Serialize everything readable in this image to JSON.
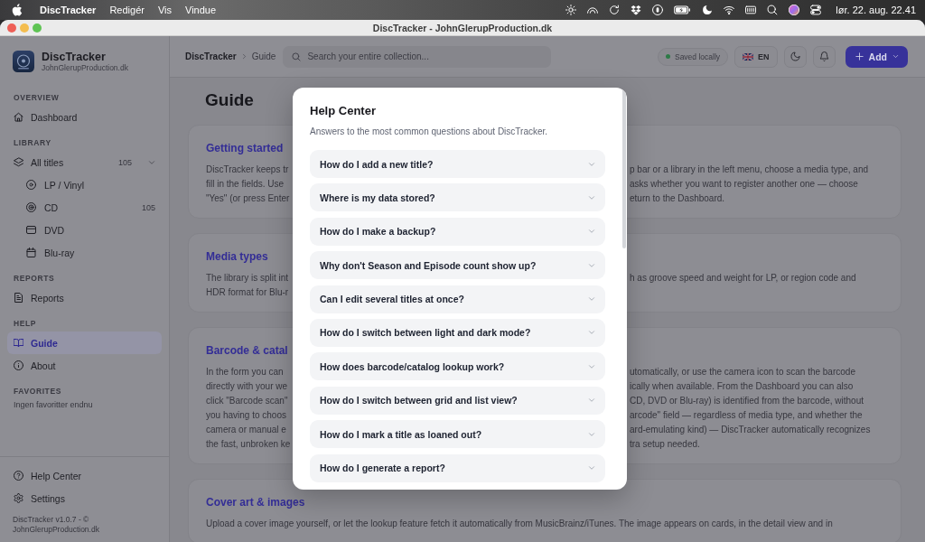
{
  "menu_bar": {
    "app_name": "DiscTracker",
    "menus": [
      "Redigér",
      "Vis",
      "Vindue"
    ],
    "clock": "lør. 22. aug. 22.41"
  },
  "window": {
    "title": "DiscTracker - JohnGlerupProduction.dk"
  },
  "sidebar": {
    "app_name": "DiscTracker",
    "app_subtitle": "JohnGlerupProduction.dk",
    "sections": [
      {
        "label": "OVERVIEW",
        "items": [
          {
            "label": "Dashboard",
            "selected": false
          }
        ]
      },
      {
        "label": "LIBRARY",
        "items": [
          {
            "label": "All titles",
            "count": "105",
            "expanded": true,
            "selected": false,
            "children": [
              {
                "label": "LP / Vinyl",
                "selected": false
              },
              {
                "label": "CD",
                "count": "105",
                "selected": false
              },
              {
                "label": "DVD",
                "selected": false
              },
              {
                "label": "Blu-ray",
                "selected": false
              }
            ]
          }
        ]
      },
      {
        "label": "REPORTS",
        "items": [
          {
            "label": "Reports",
            "selected": false
          }
        ]
      },
      {
        "label": "HELP",
        "items": [
          {
            "label": "Guide",
            "selected": true
          },
          {
            "label": "About",
            "selected": false
          }
        ]
      },
      {
        "label": "FAVORITES",
        "empty_text": "Ingen favoritter endnu"
      }
    ],
    "bottom_items": [
      {
        "label": "Help Center",
        "selected": false
      },
      {
        "label": "Settings",
        "selected": false
      }
    ],
    "footer": "DiscTracker v1.0.7 - © JohnGlerupProduction.dk"
  },
  "top_bar": {
    "breadcrumb": [
      "DiscTracker",
      "Guide"
    ],
    "search": {
      "placeholder": "Search your entire collection..."
    },
    "save_status": "Saved locally",
    "language": "EN",
    "add_button": "Add"
  },
  "page": {
    "title": "Guide",
    "sections": [
      {
        "heading": "Getting started",
        "lines": [
          {
            "left": "DiscTracker keeps tr",
            "right": "p bar or a library in the left menu, choose a media type, and"
          },
          {
            "left": "fill in the fields. Use",
            "right": "asks whether you want to register another one — choose"
          },
          {
            "left": "\"Yes\" (or press Enter",
            "right": "eturn to the Dashboard."
          }
        ]
      },
      {
        "heading": "Media types",
        "lines": [
          {
            "left": "The library is split int",
            "right": "h as groove speed and weight for LP, or region code and"
          },
          {
            "left": "HDR format for Blu-r"
          }
        ]
      },
      {
        "heading": "Barcode & catal",
        "lines": [
          {
            "left": "In the form you can",
            "right": "utomatically, or use the camera icon to scan the barcode"
          },
          {
            "left": "directly with your we",
            "right": "ically when available. From the Dashboard you can also"
          },
          {
            "left": "click \"Barcode scan\"",
            "right": "CD, DVD or Blu-ray) is identified from the barcode, without"
          },
          {
            "left": "you having to choos",
            "right": "arcode\" field — regardless of media type, and whether the"
          },
          {
            "left": "camera or manual e",
            "right": "ard-emulating kind) — DiscTracker automatically recognizes"
          },
          {
            "left": "the fast, unbroken ke",
            "right": "tra setup needed."
          }
        ]
      },
      {
        "heading": "Cover art & images",
        "lines": [
          {
            "text": "Upload a cover image yourself, or let the lookup feature fetch it automatically from MusicBrainz/iTunes. The image appears on cards, in the detail view and in"
          }
        ]
      }
    ]
  },
  "dialog": {
    "title": "Help Center",
    "subtitle": "Answers to the most common questions about DiscTracker.",
    "questions": [
      {
        "text": "How do I add a new title?",
        "expanded": false
      },
      {
        "text": "Where is my data stored?",
        "expanded": false
      },
      {
        "text": "How do I make a backup?",
        "expanded": false
      },
      {
        "text": "Why don't Season and Episode count show up?",
        "expanded": false
      },
      {
        "text": "Can I edit several titles at once?",
        "expanded": false
      },
      {
        "text": "How do I switch between light and dark mode?",
        "expanded": false
      },
      {
        "text": "How does barcode/catalog lookup work?",
        "expanded": false
      },
      {
        "text": "How do I switch between grid and list view?",
        "expanded": false
      },
      {
        "text": "How do I mark a title as loaned out?",
        "expanded": false
      },
      {
        "text": "How do I generate a report?",
        "expanded": false
      }
    ]
  }
}
